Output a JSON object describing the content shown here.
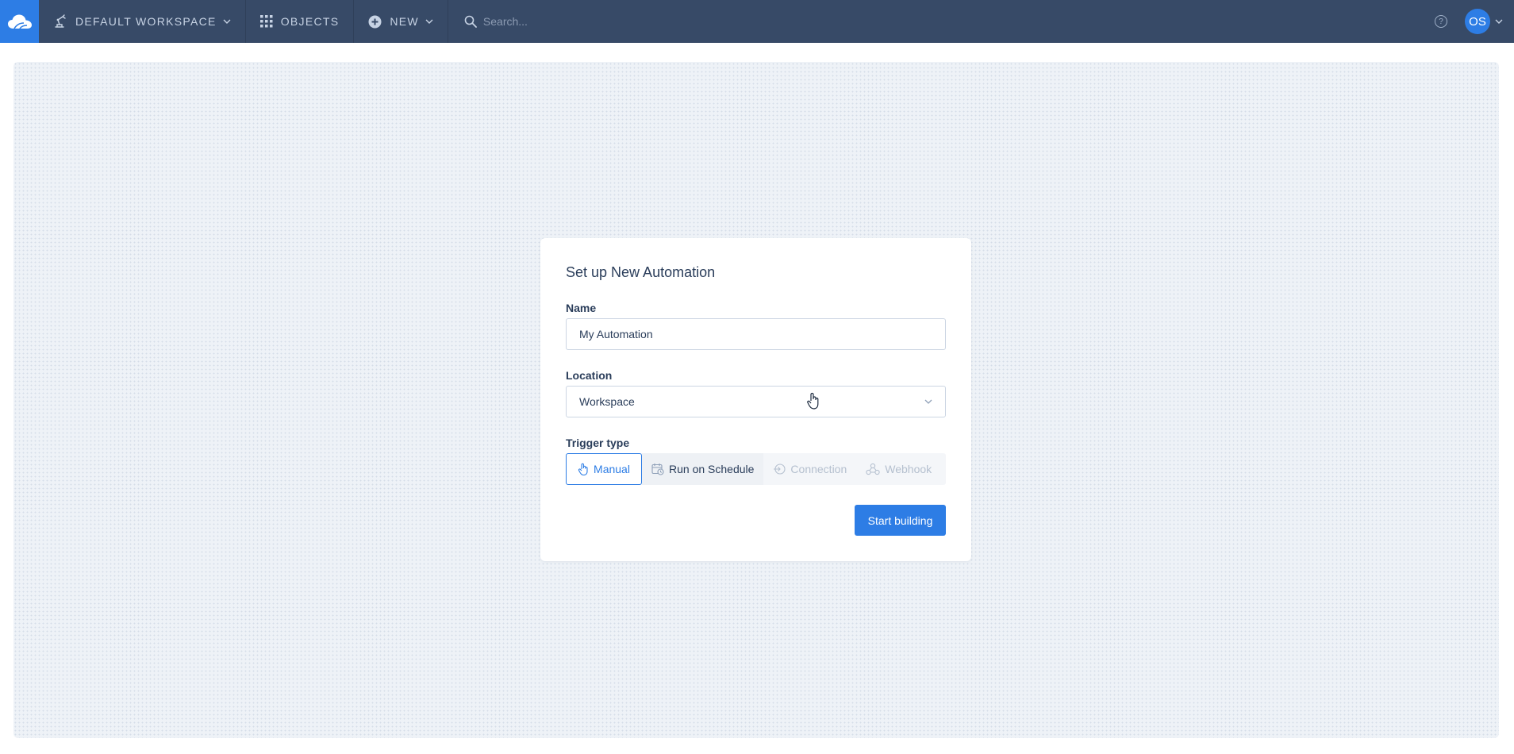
{
  "topbar": {
    "workspace_label": "DEFAULT WORKSPACE",
    "objects_label": "OBJECTS",
    "new_label": "NEW",
    "search_placeholder": "Search...",
    "help_glyph": "?",
    "user_initials": "OS"
  },
  "dialog": {
    "title": "Set up New Automation",
    "name_label": "Name",
    "name_value": "My Automation",
    "location_label": "Location",
    "location_value": "Workspace",
    "trigger_label": "Trigger type",
    "triggers": [
      {
        "label": "Manual",
        "state": "selected"
      },
      {
        "label": "Run on Schedule",
        "state": "enabled"
      },
      {
        "label": "Connection",
        "state": "disabled"
      },
      {
        "label": "Webhook",
        "state": "disabled"
      }
    ],
    "submit_label": "Start building"
  },
  "colors": {
    "topbar": "#374a67",
    "accent": "#2d7de5",
    "canvas": "#eef2f7"
  }
}
